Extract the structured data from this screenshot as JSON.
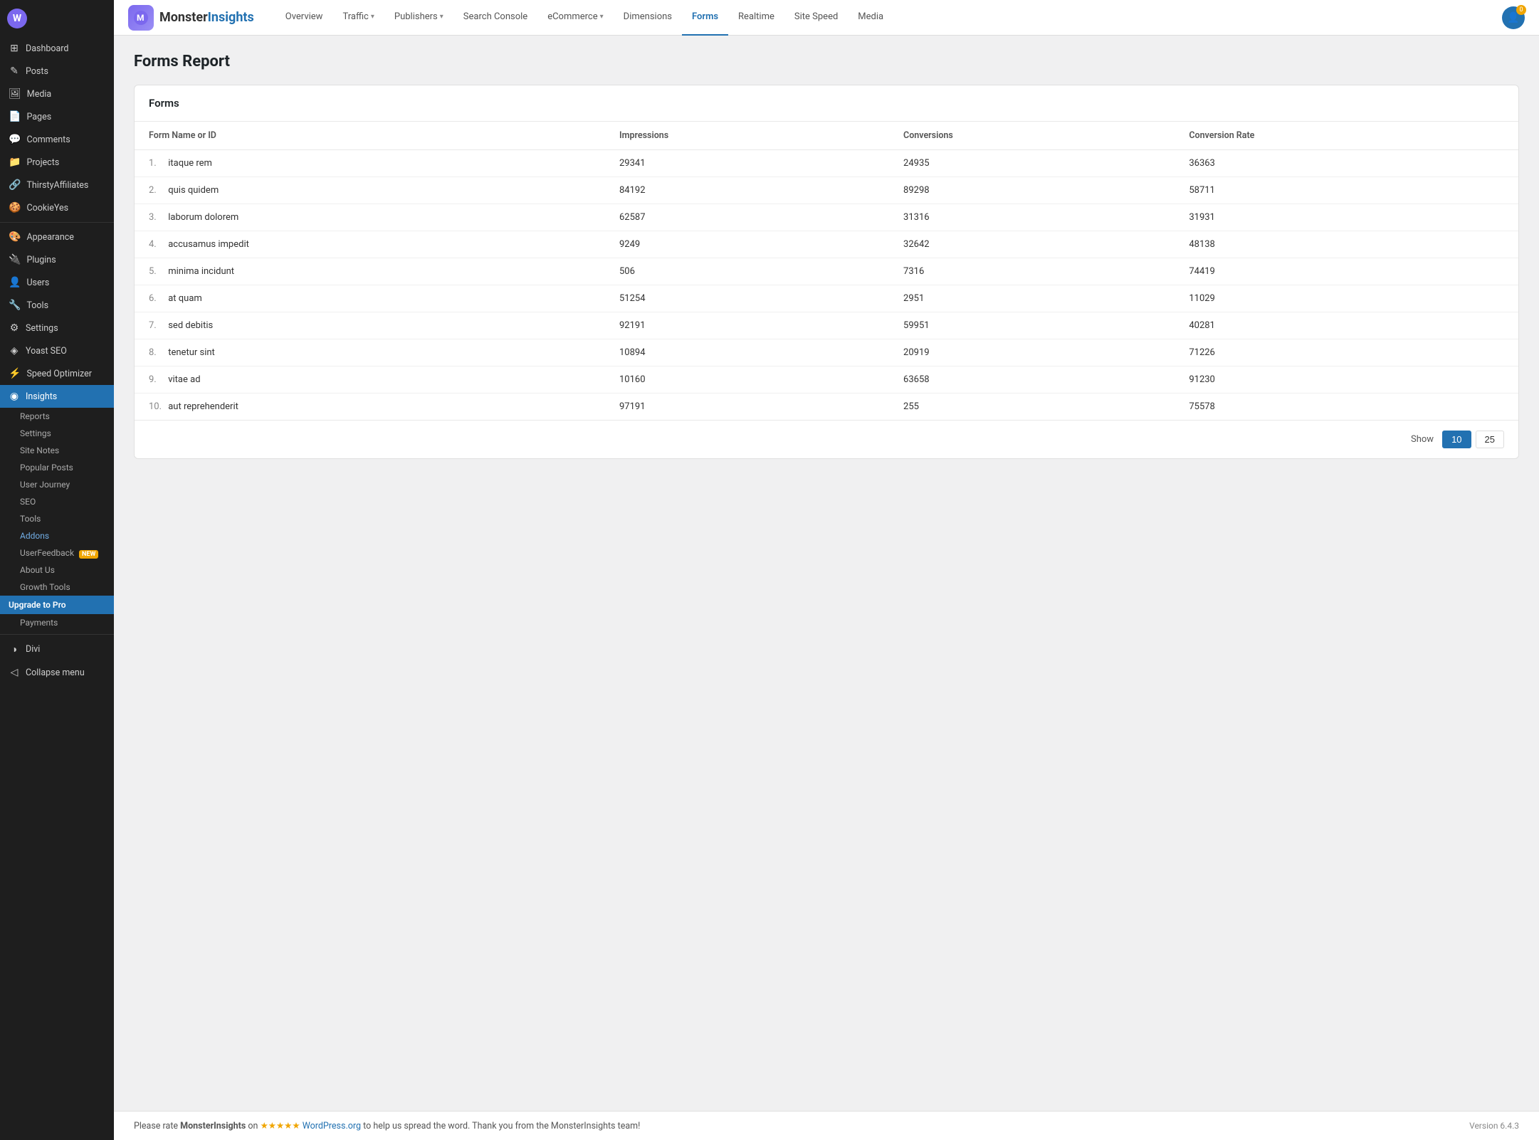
{
  "sidebar": {
    "items": [
      {
        "label": "Dashboard",
        "icon": "⊞",
        "active": false
      },
      {
        "label": "Posts",
        "icon": "✎",
        "active": false
      },
      {
        "label": "Media",
        "icon": "🖼",
        "active": false
      },
      {
        "label": "Pages",
        "icon": "📄",
        "active": false
      },
      {
        "label": "Comments",
        "icon": "💬",
        "active": false
      },
      {
        "label": "Projects",
        "icon": "📁",
        "active": false
      },
      {
        "label": "ThirstyAffiliates",
        "icon": "🔗",
        "active": false
      },
      {
        "label": "CookieYes",
        "icon": "🍪",
        "active": false
      },
      {
        "label": "Appearance",
        "icon": "🎨",
        "active": false
      },
      {
        "label": "Plugins",
        "icon": "🔌",
        "active": false
      },
      {
        "label": "Users",
        "icon": "👤",
        "active": false
      },
      {
        "label": "Tools",
        "icon": "🔧",
        "active": false
      },
      {
        "label": "Settings",
        "icon": "⚙",
        "active": false
      },
      {
        "label": "Yoast SEO",
        "icon": "◈",
        "active": false
      },
      {
        "label": "Speed Optimizer",
        "icon": "⚡",
        "active": false
      },
      {
        "label": "Insights",
        "icon": "◉",
        "active": true
      }
    ],
    "sub_items": [
      {
        "label": "Reports",
        "active": false
      },
      {
        "label": "Settings",
        "active": false
      },
      {
        "label": "Site Notes",
        "active": false
      },
      {
        "label": "Popular Posts",
        "active": false
      },
      {
        "label": "User Journey",
        "active": false
      },
      {
        "label": "SEO",
        "active": false
      },
      {
        "label": "Tools",
        "active": false
      },
      {
        "label": "Addons",
        "active": false
      },
      {
        "label": "UserFeedback",
        "active": false,
        "badge": "NEW"
      },
      {
        "label": "About Us",
        "active": false
      },
      {
        "label": "Growth Tools",
        "active": false
      }
    ],
    "upgrade_label": "Upgrade to Pro",
    "payments_label": "Payments",
    "divi_label": "Divi",
    "collapse_label": "Collapse menu"
  },
  "topbar": {
    "logo_text_plain": "Monster",
    "logo_text_colored": "Insights",
    "nav_items": [
      {
        "label": "Overview",
        "active": false,
        "has_dropdown": false
      },
      {
        "label": "Traffic",
        "active": false,
        "has_dropdown": true
      },
      {
        "label": "Publishers",
        "active": false,
        "has_dropdown": true
      },
      {
        "label": "Search Console",
        "active": false,
        "has_dropdown": false
      },
      {
        "label": "eCommerce",
        "active": false,
        "has_dropdown": true
      },
      {
        "label": "Dimensions",
        "active": false,
        "has_dropdown": false
      },
      {
        "label": "Forms",
        "active": true,
        "has_dropdown": false
      },
      {
        "label": "Realtime",
        "active": false,
        "has_dropdown": false
      },
      {
        "label": "Site Speed",
        "active": false,
        "has_dropdown": false
      },
      {
        "label": "Media",
        "active": false,
        "has_dropdown": false
      }
    ],
    "avatar_count": "0"
  },
  "page": {
    "title": "Forms Report",
    "card_title": "Forms",
    "table": {
      "columns": [
        "Form Name or ID",
        "Impressions",
        "Conversions",
        "Conversion Rate"
      ],
      "rows": [
        {
          "num": "1.",
          "name": "itaque rem",
          "impressions": "29341",
          "conversions": "24935",
          "rate": "36363"
        },
        {
          "num": "2.",
          "name": "quis quidem",
          "impressions": "84192",
          "conversions": "89298",
          "rate": "58711"
        },
        {
          "num": "3.",
          "name": "laborum dolorem",
          "impressions": "62587",
          "conversions": "31316",
          "rate": "31931"
        },
        {
          "num": "4.",
          "name": "accusamus impedit",
          "impressions": "9249",
          "conversions": "32642",
          "rate": "48138"
        },
        {
          "num": "5.",
          "name": "minima incidunt",
          "impressions": "506",
          "conversions": "7316",
          "rate": "74419"
        },
        {
          "num": "6.",
          "name": "at quam",
          "impressions": "51254",
          "conversions": "2951",
          "rate": "11029"
        },
        {
          "num": "7.",
          "name": "sed debitis",
          "impressions": "92191",
          "conversions": "59951",
          "rate": "40281"
        },
        {
          "num": "8.",
          "name": "tenetur sint",
          "impressions": "10894",
          "conversions": "20919",
          "rate": "71226"
        },
        {
          "num": "9.",
          "name": "vitae ad",
          "impressions": "10160",
          "conversions": "63658",
          "rate": "91230"
        },
        {
          "num": "10.",
          "name": "aut reprehenderit",
          "impressions": "97191",
          "conversions": "255",
          "rate": "75578"
        }
      ]
    },
    "pagination": {
      "show_label": "Show",
      "options": [
        "10",
        "25"
      ],
      "active": "10"
    }
  },
  "footer": {
    "text_before": "Please rate ",
    "brand": "MonsterInsights",
    "text_mid": " on ",
    "stars": "★★★★★",
    "link_text": "WordPress.org",
    "link_url": "#",
    "text_after": " to help us spread the word. Thank you from the MonsterInsights team!",
    "version": "Version 6.4.3"
  }
}
